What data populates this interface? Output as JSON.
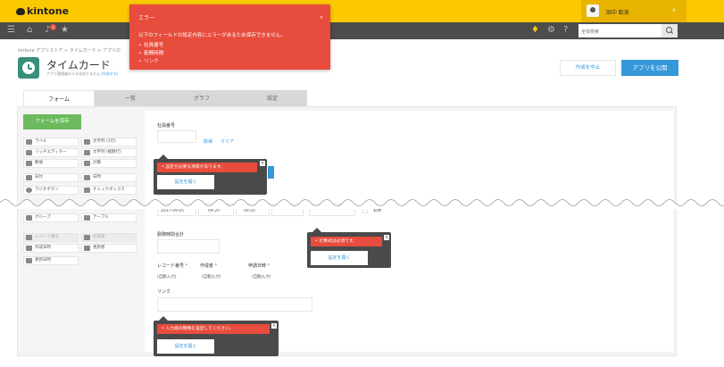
{
  "header": {
    "logo": "kintone",
    "user_name": "田中 歓美",
    "dropdown": "∨"
  },
  "nav": {
    "notification_count": "4",
    "search_placeholder": "全体検索"
  },
  "breadcrumb": [
    "kintone アプリストア",
    "タイムカード",
    "アプリの"
  ],
  "app": {
    "title": "タイムカード",
    "subtitle": "アプリ管理者のメモはありません",
    "subtitle_link": "(作成する)"
  },
  "actions": {
    "cancel": "作成を中止",
    "publish": "アプリを公開"
  },
  "tabs": [
    "フォーム",
    "一覧",
    "グラフ",
    "設定"
  ],
  "palette": {
    "save_form": "フォームを保存",
    "items": [
      "ラベル",
      "文字列 (1行)",
      "リッチエディター",
      "文字列 (複数行)",
      "数値",
      "計算",
      "日付",
      "日時",
      "ラジオボタン",
      "チェックボックス",
      "ドロップダウン",
      "ユーザー選択",
      "グループ",
      "テーブル"
    ],
    "system_items": [
      "レコード番号",
      "作成者",
      "作成日時",
      "更新者",
      "更新日時"
    ]
  },
  "form": {
    "employee_label": "社員番号",
    "fetch": "取得",
    "clear": "クリア",
    "row_values": [
      "2017-09-05",
      "09:20",
      "09:20",
      "有休"
    ],
    "total_label": "勤務時間合計",
    "record_no_label": "レコード番号",
    "creator_label": "作成者",
    "date_label": "申請日時",
    "auto": "(自動入力)",
    "link_label": "リンク"
  },
  "errors": {
    "popup1": "設定が必要な項目があります。",
    "popup2": "計算式は必須です。",
    "popup3": "入力値の種類を設定してください。",
    "open_settings": "設定を開く",
    "close": "×"
  },
  "toast": {
    "title": "エラー",
    "message": "以下のフィールドの設定内容にエラーがあるため保存できません。",
    "fields": [
      "社員番号",
      "勤務時間",
      "リンク"
    ],
    "close": "×"
  },
  "icons": [
    "menu-icon",
    "home-icon",
    "bell-icon",
    "star-icon",
    "sprout-icon",
    "gear-icon",
    "help-icon",
    "search-icon"
  ],
  "colors": {
    "topbar": "#fcc800",
    "nav": "#4c4c4c",
    "error": "#e74c3c",
    "primary": "#3498db",
    "save": "#6cb95e"
  }
}
